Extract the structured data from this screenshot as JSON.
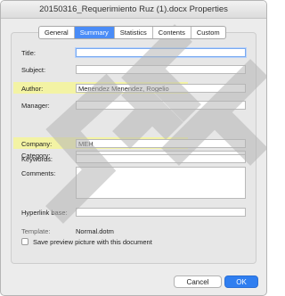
{
  "window": {
    "title": "20150316_Requerimiento Ruz (1).docx Properties"
  },
  "tabs": [
    {
      "label": "General",
      "active": false
    },
    {
      "label": "Summary",
      "active": true
    },
    {
      "label": "Statistics",
      "active": false
    },
    {
      "label": "Contents",
      "active": false
    },
    {
      "label": "Custom",
      "active": false
    }
  ],
  "form": {
    "title": {
      "label": "Title:",
      "value": ""
    },
    "subject": {
      "label": "Subject:",
      "value": ""
    },
    "author": {
      "label": "Author:",
      "value": "Menendez Menendez, Rogelio"
    },
    "manager": {
      "label": "Manager:",
      "value": ""
    },
    "company": {
      "label": "Company:",
      "value": "MEH"
    },
    "category": {
      "label": "Category:",
      "value": ""
    },
    "keywords": {
      "label": "Keywords:",
      "value": ""
    },
    "comments": {
      "label": "Comments:",
      "value": ""
    },
    "hyperlink_base": {
      "label": "Hyperlink base:",
      "value": ""
    },
    "template": {
      "label": "Template:",
      "value": "Normal.dotm"
    },
    "save_preview": {
      "label": "Save preview picture with this document",
      "checked": false
    }
  },
  "buttons": {
    "cancel": "Cancel",
    "ok": "OK"
  },
  "colors": {
    "accent": "#4a8cf7",
    "highlight": "#f4f49c",
    "watermark": "#b4b4b4"
  }
}
